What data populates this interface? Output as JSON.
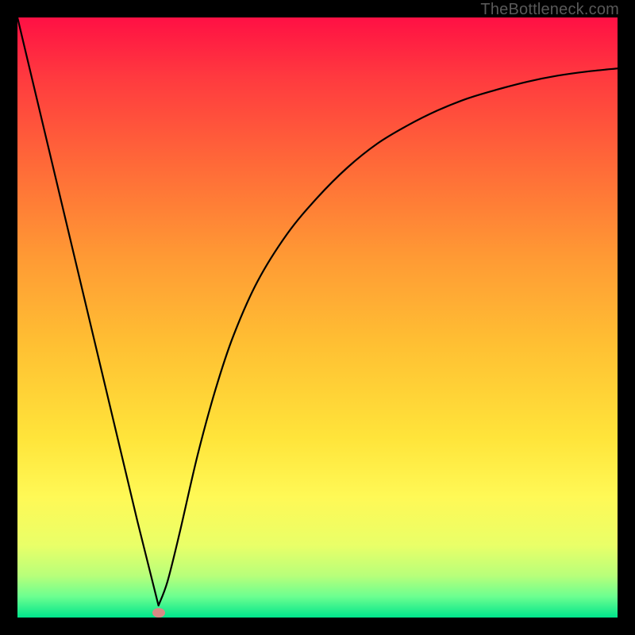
{
  "watermark": "TheBottleneck.com",
  "chart_data": {
    "type": "line",
    "title": "",
    "xlabel": "",
    "ylabel": "",
    "xlim": [
      0,
      100
    ],
    "ylim": [
      0,
      100
    ],
    "grid": false,
    "series": [
      {
        "name": "bottleneck-curve",
        "x": [
          0,
          5,
          10,
          15,
          20,
          22,
          23.5,
          25,
          27,
          30,
          33,
          36,
          40,
          45,
          50,
          55,
          60,
          65,
          70,
          75,
          80,
          85,
          90,
          95,
          100
        ],
        "values": [
          100,
          79,
          58,
          37,
          16,
          8,
          2,
          6,
          14,
          27,
          38,
          47,
          56,
          64,
          70,
          75,
          79,
          82,
          84.5,
          86.5,
          88,
          89.3,
          90.3,
          91,
          91.5
        ]
      }
    ],
    "marker": {
      "x": 23.5,
      "y": 0.8,
      "color": "#d88a85"
    },
    "background_gradient": {
      "stops": [
        {
          "offset": 0.0,
          "color": "#ff1044"
        },
        {
          "offset": 0.1,
          "color": "#ff3a3f"
        },
        {
          "offset": 0.25,
          "color": "#ff6b38"
        },
        {
          "offset": 0.4,
          "color": "#ff9a34"
        },
        {
          "offset": 0.55,
          "color": "#ffc133"
        },
        {
          "offset": 0.7,
          "color": "#ffe43a"
        },
        {
          "offset": 0.8,
          "color": "#fff956"
        },
        {
          "offset": 0.88,
          "color": "#e9ff68"
        },
        {
          "offset": 0.93,
          "color": "#b8ff7a"
        },
        {
          "offset": 0.965,
          "color": "#6cff90"
        },
        {
          "offset": 1.0,
          "color": "#00e58b"
        }
      ]
    }
  }
}
